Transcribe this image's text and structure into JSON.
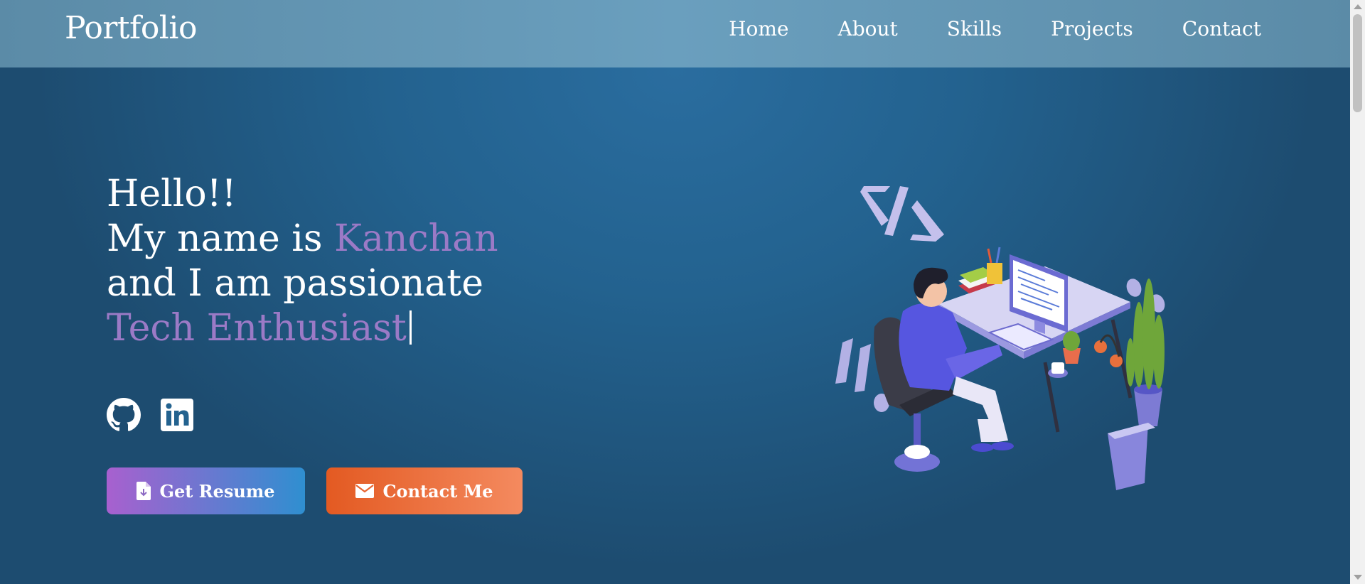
{
  "nav": {
    "brand": "Portfolio",
    "links": [
      "Home",
      "About",
      "Skills",
      "Projects",
      "Contact"
    ]
  },
  "hero": {
    "line1": "Hello!!",
    "line2_prefix": "My name is ",
    "name": "Kanchan",
    "line3": "and I am passionate",
    "typed_text": "Tech Enthusiast"
  },
  "socials": [
    {
      "icon": "github-icon"
    },
    {
      "icon": "linkedin-icon"
    }
  ],
  "buttons": {
    "resume_label": "Get Resume",
    "resume_icon": "file-download-icon",
    "contact_label": "Contact Me",
    "contact_icon": "envelope-icon"
  },
  "colors": {
    "accent": "#9b7ac6",
    "nav_bg": "#6a9fbe",
    "hero_bg": "#23628f",
    "resume_gradient": [
      "#a860cf",
      "#2f8fd0"
    ],
    "contact_gradient": [
      "#e35a22",
      "#f48a5f"
    ]
  }
}
